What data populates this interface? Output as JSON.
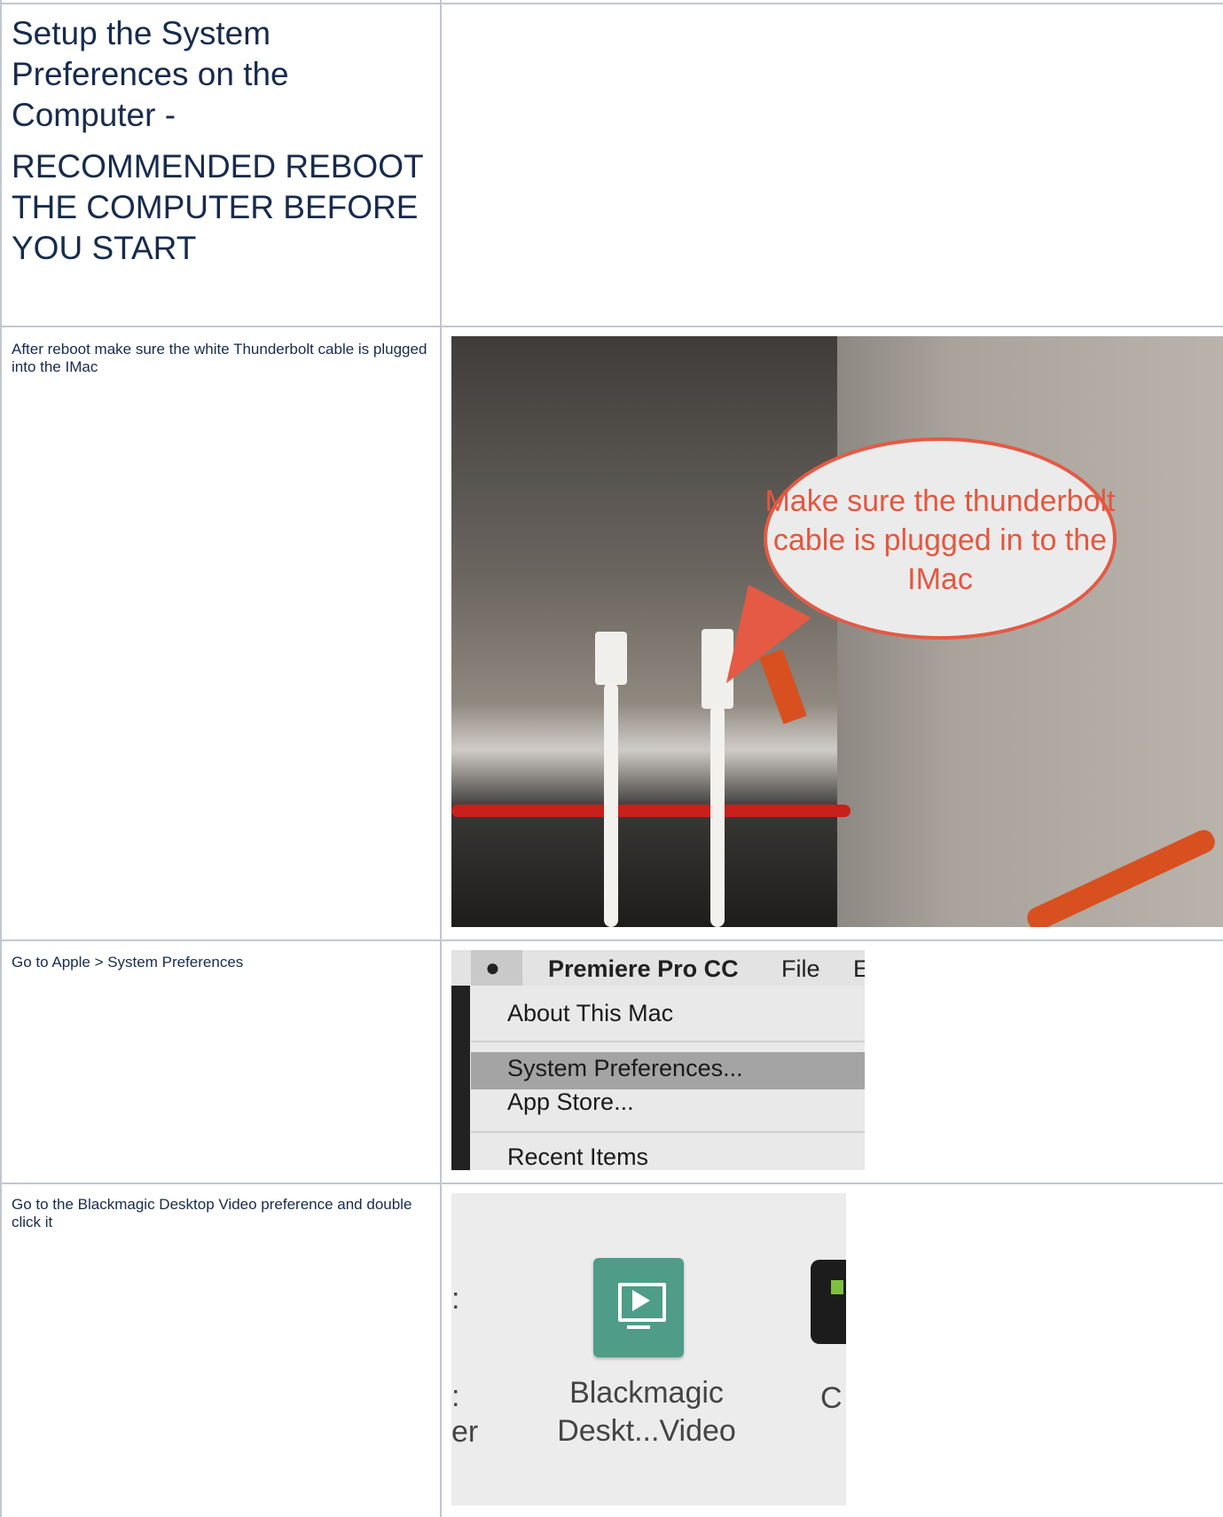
{
  "rows": [
    {
      "left_title": "Setup the System Preferences on the Computer -",
      "left_subtitle": "RECOMMENDED REBOOT THE COMPUTER BEFORE YOU START"
    },
    {
      "text": "After reboot make sure the white Thunderbolt cable is plugged into the IMac",
      "image": {
        "callout_text": "Make sure the thunderbolt cable is plugged in to the IMac"
      }
    },
    {
      "text": "Go to Apple > System Preferences",
      "image": {
        "apple_icon": "apple-logo-icon",
        "app_name": "Premiere Pro CC",
        "menu_file": "File",
        "menu_edit_partial": "E",
        "items": [
          "About This Mac",
          "System Preferences...",
          "App Store...",
          "Recent Items"
        ],
        "highlighted_item": "System Preferences..."
      }
    },
    {
      "text": "Go to the Blackmagic Desktop Video preference and double click it",
      "image": {
        "icon": "blackmagic-desktop-video-icon",
        "label_line1": "Blackmagic",
        "label_line2": "Deskt...Video",
        "right_fragment": "C",
        "left_fragment_1": ":",
        "left_fragment_2": "er"
      }
    }
  ],
  "colors": {
    "border": "#c1c7d0",
    "text": "#172b4d",
    "callout": "#e4573f",
    "pref_tile": "#4f9c89"
  }
}
